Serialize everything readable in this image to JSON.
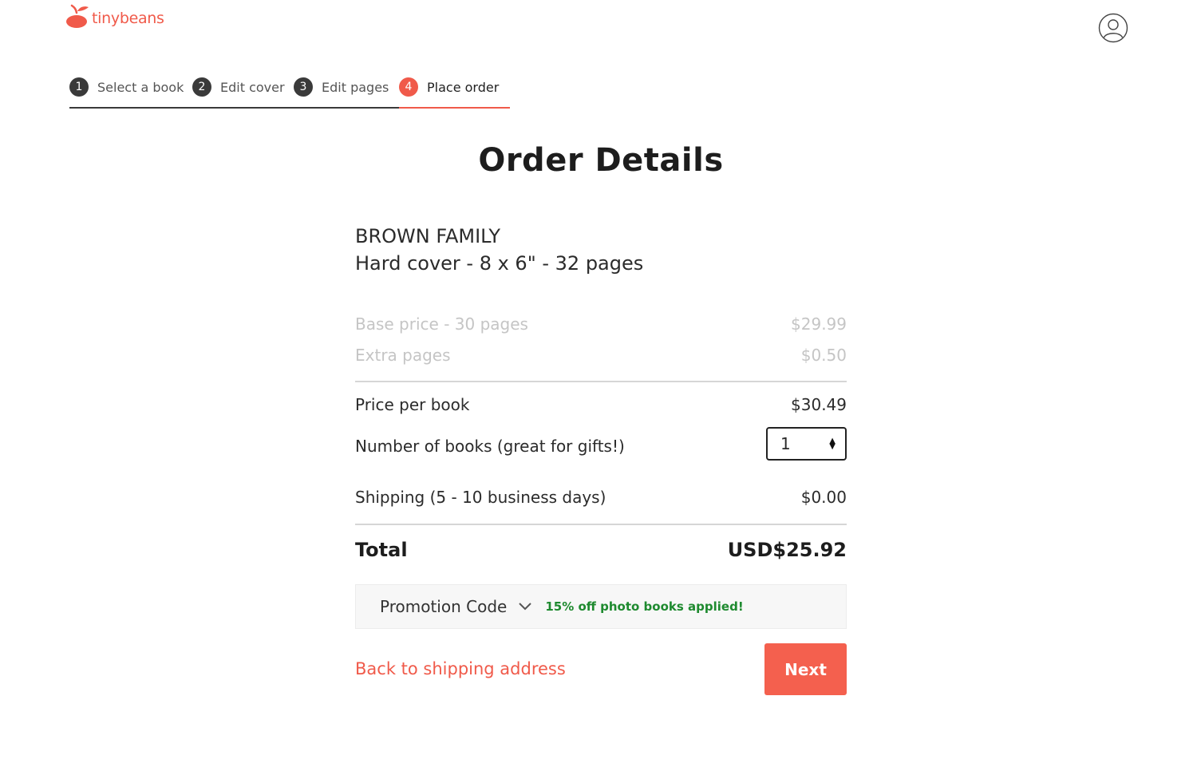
{
  "header": {
    "logo_text": "tinybeans",
    "brand_color": "#f05a4a",
    "logo_icon": "cherry-logo-icon",
    "profile_icon": "user-avatar-icon"
  },
  "stepper": {
    "active_color": "#f05a4a",
    "steps": [
      {
        "number": "1",
        "label": "Select a book"
      },
      {
        "number": "2",
        "label": "Edit cover"
      },
      {
        "number": "3",
        "label": "Edit pages"
      },
      {
        "number": "4",
        "label": "Place order",
        "active": true
      }
    ]
  },
  "main": {
    "title": "Order Details",
    "book": {
      "name": "BROWN FAMILY",
      "spec": "Hard cover - 8 x 6\" - 32 pages"
    },
    "price_breakdown": [
      {
        "label": "Base price - 30 pages",
        "value": "$29.99"
      },
      {
        "label": "Extra pages",
        "value": "$0.50"
      }
    ],
    "price_per_book": {
      "label": "Price per book",
      "value": "$30.49"
    },
    "quantity": {
      "label": "Number of books (great for gifts!)",
      "value": "1"
    },
    "shipping": {
      "label": "Shipping (5 - 10 business days)",
      "value": "$0.00"
    },
    "total": {
      "label": "Total",
      "value": "USD$25.92"
    },
    "promo": {
      "label": "Promotion Code",
      "message": "15% off photo books applied!",
      "message_color": "#1e8a2f"
    },
    "back_link": "Back to shipping address",
    "next_label": "Next"
  }
}
